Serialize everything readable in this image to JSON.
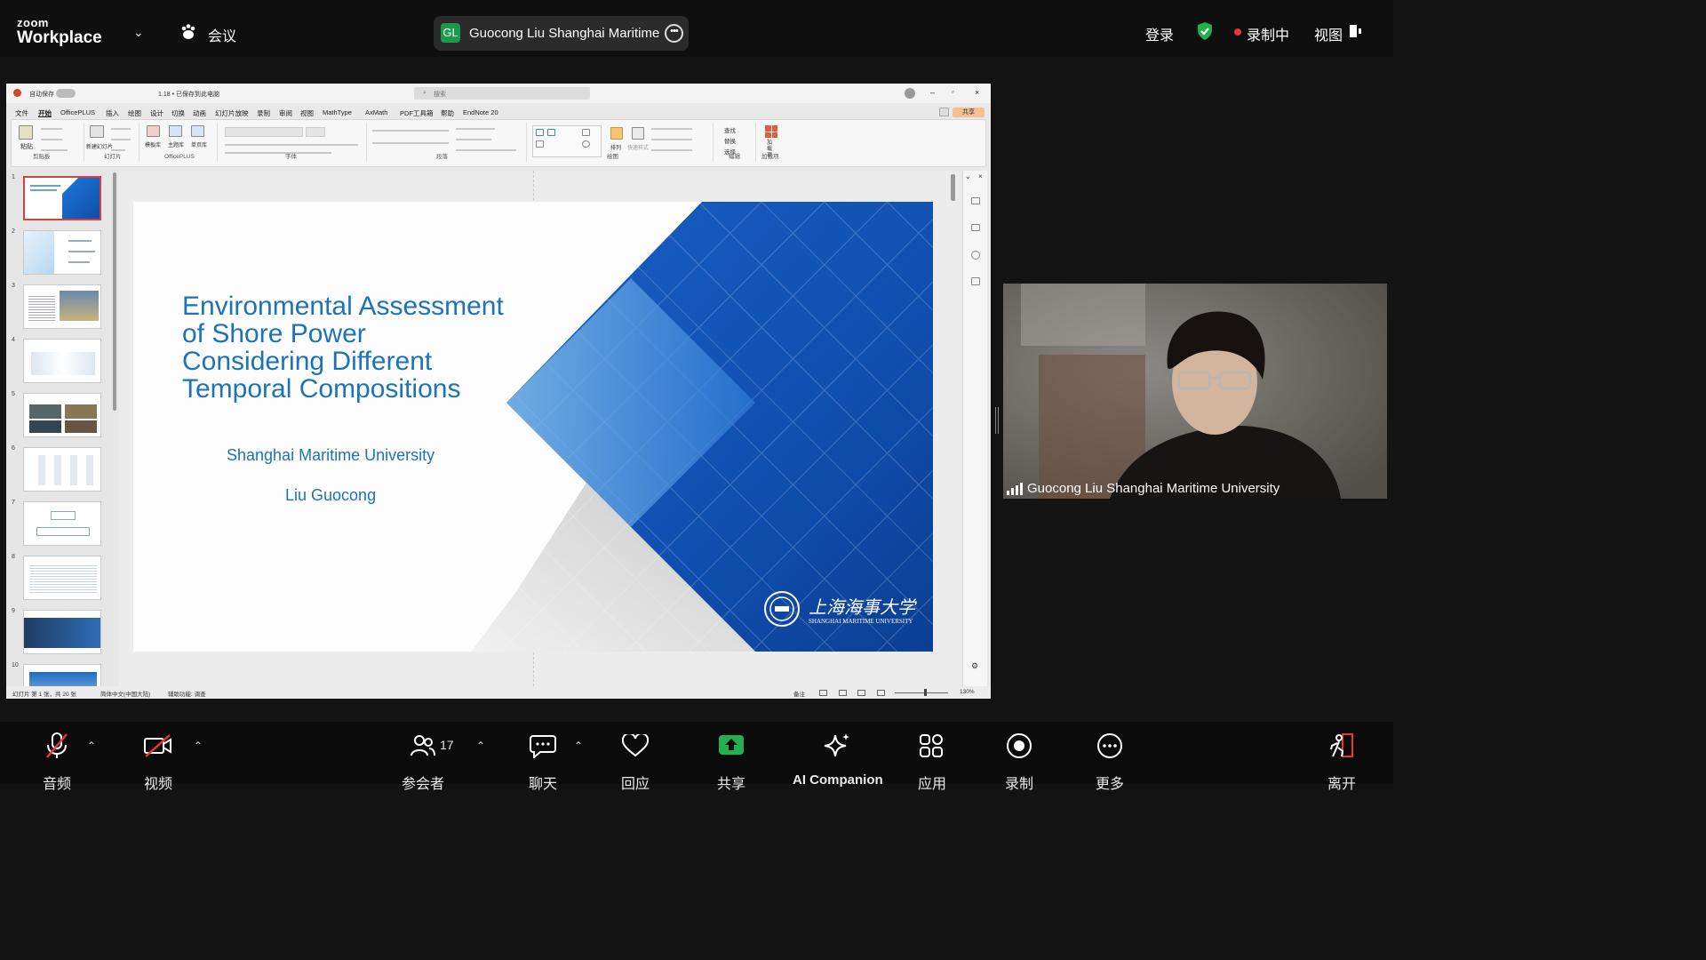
{
  "topbar": {
    "logo_top": "zoom",
    "logo_bottom": "Workplace",
    "meeting_label": "会议",
    "speaker_initials": "GL",
    "speaker_name": "Guocong Liu Shanghai Maritime",
    "login": "登录",
    "recording": "录制中",
    "view": "视图",
    "record_color": "#e53935",
    "shield_color": "#23b04e"
  },
  "ppt": {
    "autosave": "自动保存",
    "filename": "1.18 • 已保存到此电脑",
    "search_placeholder": "搜索",
    "share": "共享",
    "tabs": [
      "文件",
      "开始",
      "OfficePLUS",
      "插入",
      "绘图",
      "设计",
      "切换",
      "动画",
      "幻灯片放映",
      "录制",
      "审阅",
      "视图",
      "MathType",
      "AxMath",
      "PDF工具箱",
      "帮助",
      "EndNote 20"
    ],
    "groups": [
      "剪贴板",
      "幻灯片",
      "OfficePLUS",
      "字体",
      "段落",
      "绘图",
      "编辑",
      "加载项"
    ],
    "group_buttons": {
      "paste": "粘贴",
      "new_slide": "新建幻灯片",
      "template": "模板库",
      "theme": "主题库",
      "single": "单页库",
      "arrange": "排列",
      "quick_style": "快速样式",
      "find": "查找",
      "replace": "替换",
      "select": "选择",
      "addin": "加载项"
    },
    "slide_numbers": [
      "1",
      "2",
      "3",
      "4",
      "5",
      "6",
      "7",
      "8",
      "9",
      "10"
    ],
    "status": {
      "slide_info": "幻灯片 第 1 张，共 20 张",
      "language": "简体中文(中国大陆)",
      "accessibility": "辅助功能: 调查",
      "notes": "备注",
      "zoom": "130%"
    }
  },
  "slide": {
    "title_lines": [
      "Environmental Assessment",
      "of Shore Power",
      "Considering Different",
      "Temporal Compositions"
    ],
    "university": "Shanghai Maritime University",
    "author": "Liu Guocong",
    "logo_cn": "上海海事大学",
    "logo_en": "SHANGHAI MARITIME UNIVERSITY",
    "brand_blue": "#1d73b8"
  },
  "video": {
    "participant": "Guocong Liu Shanghai Maritime University"
  },
  "toolbar": {
    "audio": "音频",
    "video": "视频",
    "participants": "参会者",
    "participants_count": "17",
    "chat": "聊天",
    "react": "回应",
    "share": "共享",
    "ai": "AI Companion",
    "apps": "应用",
    "record": "录制",
    "more": "更多",
    "leave": "离开",
    "share_color": "#23b04e",
    "leave_color": "#e53935"
  }
}
